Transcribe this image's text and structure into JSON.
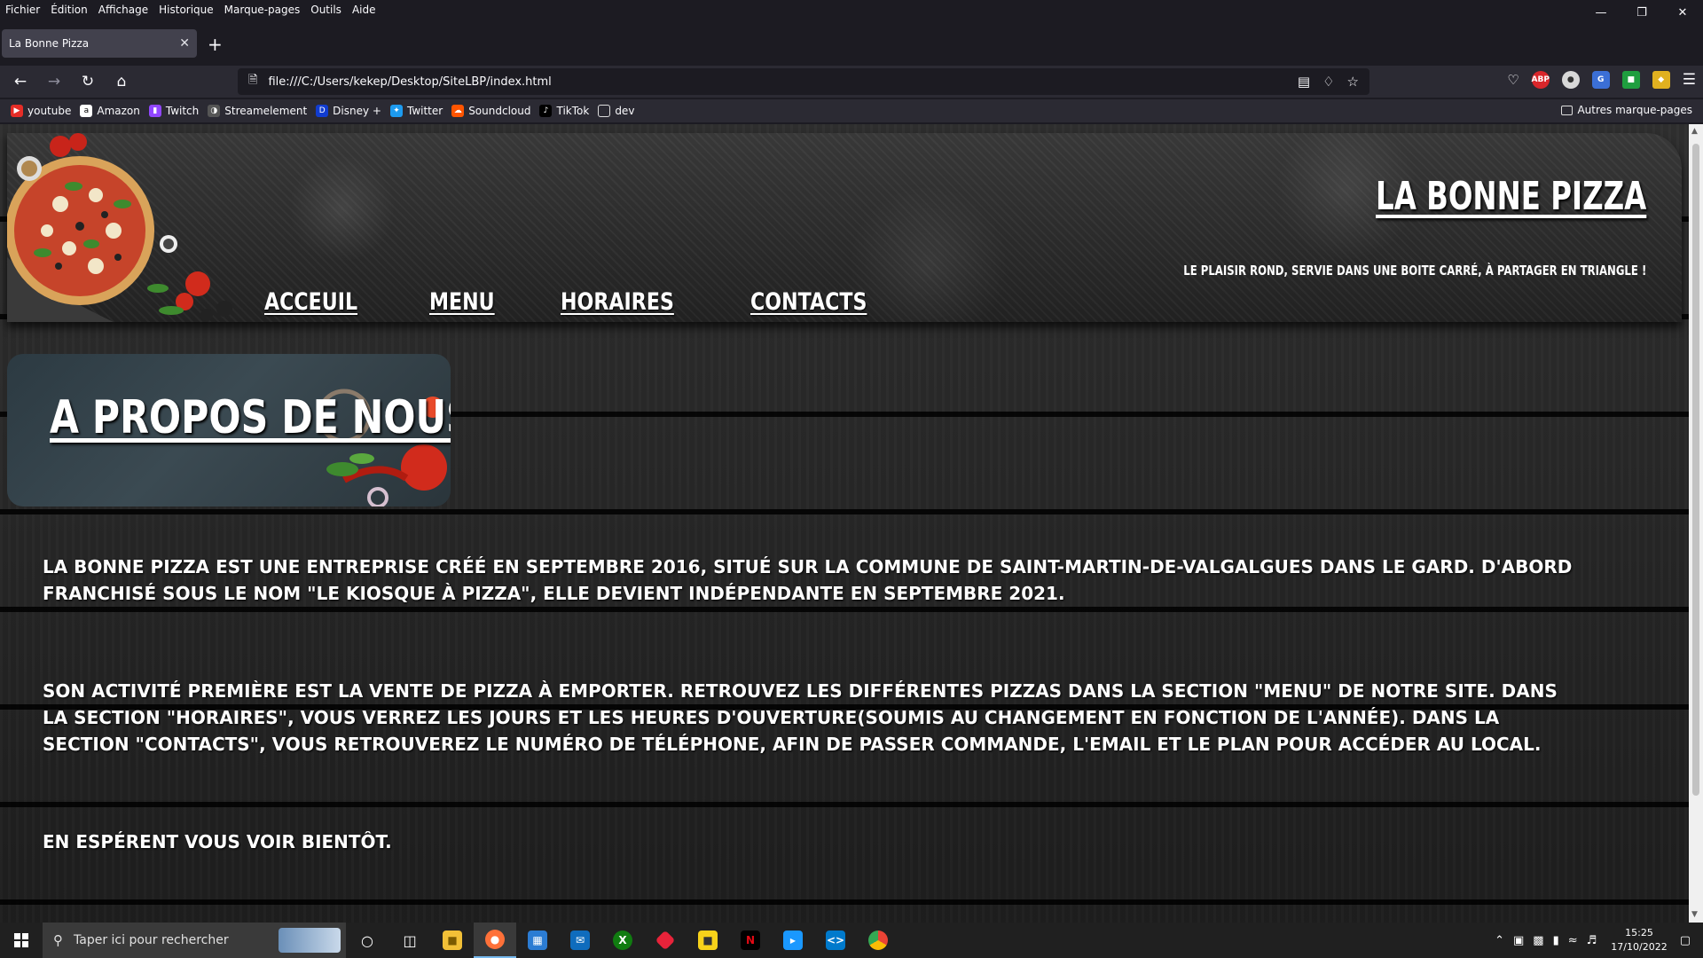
{
  "browser": {
    "menu": [
      "Fichier",
      "Édition",
      "Affichage",
      "Historique",
      "Marque-pages",
      "Outils",
      "Aide"
    ],
    "tab_title": "La Bonne Pizza",
    "url": "file:///C:/Users/kekep/Desktop/SiteLBP/index.html",
    "bookmarks": [
      "youtube",
      "Amazon",
      "Twitch",
      "Streamelement",
      "Disney +",
      "Twitter",
      "Soundcloud",
      "TikTok",
      "dev"
    ],
    "other_bookmarks": "Autres marque-pages"
  },
  "site": {
    "title": "LA BONNE PIZZA",
    "slogan": "LE PLAISIR ROND, SERVIE DANS UNE BOITE CARRÉ, À PARTAGER EN TRIANGLE !",
    "nav": [
      "ACCEUIL",
      "MENU",
      "HORAIRES",
      "CONTACTS"
    ],
    "about_title": "A PROPOS DE NOUS!",
    "paragraphs": [
      "LA BONNE PIZZA EST UNE ENTREPRISE CRÉÉ EN SEPTEMBRE 2016, SITUÉ SUR LA COMMUNE DE SAINT-MARTIN-DE-VALGALGUES DANS LE GARD. D'ABORD FRANCHISÉ SOUS LE NOM \"LE KIOSQUE À PIZZA\", ELLE DEVIENT INDÉPENDANTE EN SEPTEMBRE 2021.",
      "SON ACTIVITÉ PREMIÈRE EST LA VENTE DE PIZZA À EMPORTER. RETROUVEZ LES DIFFÉRENTES PIZZAS DANS LA SECTION \"MENU\" DE NOTRE SITE. DANS LA SECTION \"HORAIRES\", VOUS VERREZ LES JOURS ET LES HEURES D'OUVERTURE(SOUMIS AU CHANGEMENT EN FONCTION DE L'ANNÉE). DANS LA SECTION \"CONTACTS\", VOUS RETROUVEREZ LE NUMÉRO DE TÉLÉPHONE, AFIN DE PASSER COMMANDE, L'EMAIL ET LE PLAN POUR ACCÉDER AU LOCAL.",
      "EN ESPÉRENT VOUS VOIR BIENTÔT."
    ]
  },
  "taskbar": {
    "search_placeholder": "Taper ici pour rechercher",
    "time": "15:25",
    "date": "17/10/2022"
  }
}
